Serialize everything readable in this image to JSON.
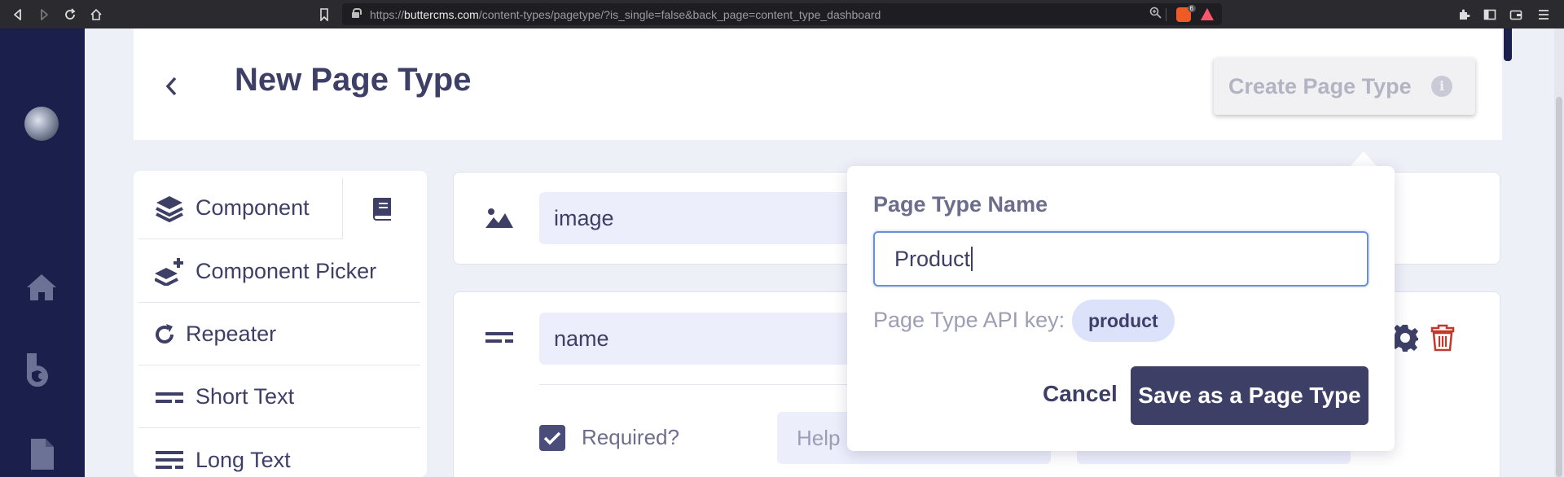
{
  "browser": {
    "url_scheme": "https://",
    "url_host": "buttercms.com",
    "url_path": "/content-types/pagetype/?is_single=false&back_page=content_type_dashboard",
    "brave_badge": "6",
    "icons": [
      "back-icon",
      "forward-icon",
      "reload-icon",
      "home-icon",
      "bookmark-icon",
      "lock-icon",
      "zoom-icon",
      "brave-icon",
      "triangle-icon",
      "extensions-icon",
      "sidebar-icon",
      "wallet-icon",
      "menu-icon"
    ]
  },
  "app_sidebar": {
    "icons": [
      "avatar",
      "home-icon",
      "blog-icon",
      "page-icon"
    ]
  },
  "header": {
    "title": "New Page Type",
    "create_button": "Create Page Type",
    "info_glyph": "i"
  },
  "field_types": [
    {
      "label": "Component",
      "icon": "layers-icon"
    },
    {
      "label": "Component Picker",
      "icon": "layers-plus-icon"
    },
    {
      "label": "Repeater",
      "icon": "repeat-icon"
    },
    {
      "label": "Short Text",
      "icon": "short-text-icon"
    },
    {
      "label": "Long Text",
      "icon": "long-text-icon"
    }
  ],
  "fields": [
    {
      "name": "image",
      "icon": "image-icon"
    },
    {
      "name": "name",
      "icon": "short-text-icon"
    }
  ],
  "field_options": {
    "required_label": "Required?",
    "required_checked": true,
    "help_placeholder": "Help"
  },
  "popover": {
    "label": "Page Type Name",
    "input_value": "Product",
    "api_label": "Page Type API key:",
    "api_key": "product",
    "cancel": "Cancel",
    "save": "Save as a Page Type"
  },
  "colors": {
    "sidebar": "#1b1f4b",
    "primary": "#3d3f66",
    "api_badge": "#dde2fb",
    "trash": "#c0392b",
    "focus": "#6a8fd8"
  }
}
